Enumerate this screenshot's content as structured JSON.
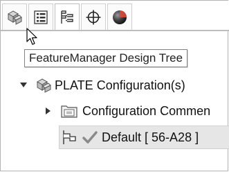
{
  "tabs": [
    {
      "name": "feature-manager",
      "icon": "feature-tree-icon",
      "active": false
    },
    {
      "name": "property-manager",
      "icon": "property-manager-icon",
      "active": false
    },
    {
      "name": "configuration-manager",
      "icon": "configuration-manager-icon",
      "active": true
    },
    {
      "name": "dimxpert-manager",
      "icon": "crosshair-icon",
      "active": false
    },
    {
      "name": "display-manager",
      "icon": "appearance-sphere-icon",
      "active": false
    }
  ],
  "tooltip": {
    "text": "FeatureManager Design Tree"
  },
  "tree": {
    "root": {
      "label": "PLATE Configuration(s)",
      "expanded": true,
      "icon": "parts-icon"
    },
    "folder": {
      "label": "Configuration Commen",
      "expanded": false,
      "icon": "folder-icon"
    },
    "config": {
      "label": "Default [ 56-A28 ]",
      "icon": "configuration-flag-icon",
      "status_icon": "checkmark-icon",
      "selected": true
    }
  },
  "colors": {
    "accent_red": "#d94b3c",
    "check_gray": "#8a8a8a"
  }
}
